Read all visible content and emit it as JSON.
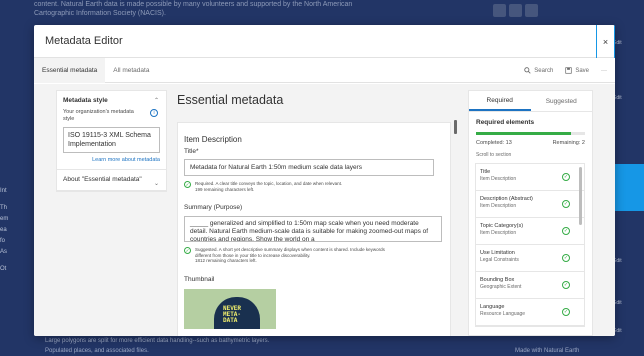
{
  "background": {
    "text_line1": "content. Natural Earth data is made possible by many volunteers and supported by the North American",
    "text_line2": "Cartographic Information Society (NACIS).",
    "left_fragments": [
      "Int",
      "Th",
      "em",
      "ea",
      "fo",
      "As",
      "Ot"
    ],
    "right_fragments": [
      "Edit",
      "Edit",
      "Edit",
      "Edit",
      "Edit"
    ],
    "bottom_line1": "Large polygons are split for more efficient data handling--such as bathymetric layers.",
    "bottom_line2": "Populated places, and associated files.",
    "bottom_right": "Made with Natural Earth"
  },
  "modal": {
    "title": "Metadata Editor",
    "close_glyph": "×"
  },
  "tabs": [
    {
      "label": "Essential metadata",
      "active": true
    },
    {
      "label": "All metadata",
      "active": false
    }
  ],
  "actions": {
    "search_label": "Search",
    "save_label": "Save",
    "more_glyph": "···"
  },
  "left_panel": {
    "style_heading": "Metadata style",
    "style_field_label": "Your organization's metadata style",
    "style_value": "ISO 19115-3 XML Schema Implementation",
    "learn_more_link": "Learn more about metadata",
    "about_heading": "About \"Essential metadata\""
  },
  "main": {
    "title": "Essential metadata",
    "card_title": "Item Description",
    "title_label": "Title*",
    "title_value": "Metadata for Natural Earth 1:50m medium scale data layers",
    "title_hint_line1": "Required. A clear title conveys the topic, location, and date when relevant.",
    "title_hint_line2": "199 remaining characters left.",
    "summary_label": "Summary (Purpose)",
    "summary_value": "_____ generalized and simplified to 1:50m map scale when you need moderate detail. Natural Earth medium-scale data is suitable for making zoomed-out maps of countries and regions. Show the world on a",
    "summary_hint_line1": "Suggested. A short yet descriptive summary displays when content is shared. Include keywords",
    "summary_hint_line2": "different from those in your title to increase discoverability.",
    "summary_hint_line3": "1812 remaining characters left.",
    "thumbnail_label": "Thumbnail",
    "thumbnail_text": "NEVER\nMETA-\nDATA"
  },
  "right_panel": {
    "tab_required": "Required",
    "tab_suggested": "Suggested",
    "heading": "Required elements",
    "progress": 0.87,
    "completed": "Completed: 13",
    "remaining": "Remaining: 2",
    "scroll_label": "Scroll to section",
    "items": [
      {
        "title": "Title",
        "sub": "Item Description"
      },
      {
        "title": "Description (Abstract)",
        "sub": "Item Description"
      },
      {
        "title": "Topic Category(s)",
        "sub": "Item Description"
      },
      {
        "title": "Use Limitation",
        "sub": "Legal Constraints"
      },
      {
        "title": "Bounding Box",
        "sub": "Geographic Extent"
      },
      {
        "title": "Language",
        "sub": "Resource Language"
      }
    ]
  },
  "colors": {
    "accent": "#1d73c2",
    "success": "#35ac46",
    "highlight": "#1697e6"
  }
}
